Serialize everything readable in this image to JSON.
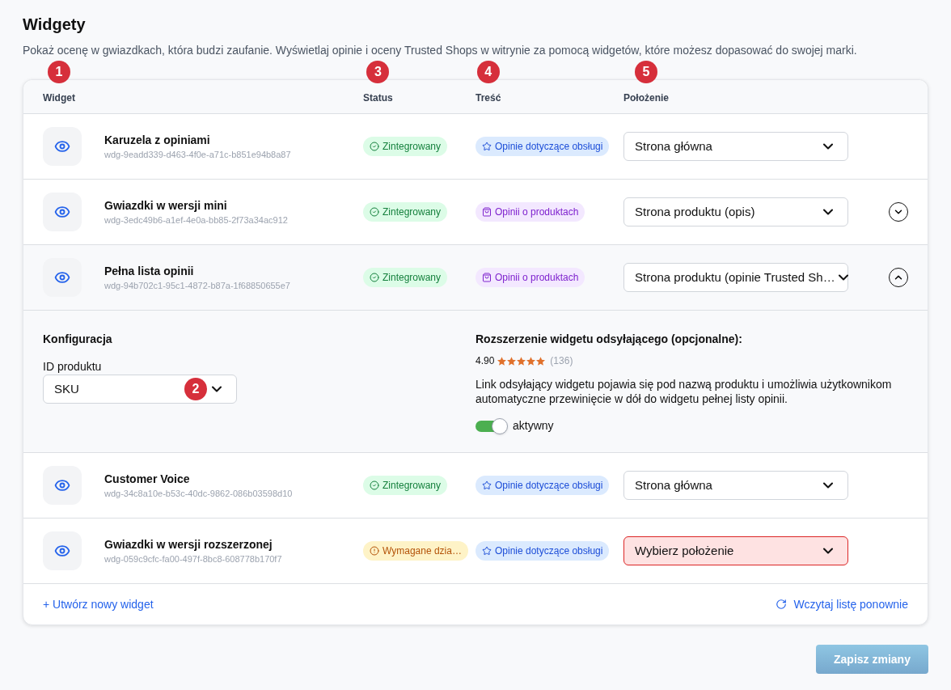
{
  "page": {
    "title": "Widgety",
    "description": "Pokaż ocenę w gwiazdkach, która budzi zaufanie. Wyświetlaj opinie i oceny Trusted Shops w witrynie za pomocą widgetów, które możesz dopasować do swojej marki."
  },
  "table": {
    "columns": [
      {
        "label": "Widget",
        "marker": "1"
      },
      {
        "label": "Status",
        "marker": "3"
      },
      {
        "label": "Treść",
        "marker": "4"
      },
      {
        "label": "Położenie",
        "marker": "5"
      }
    ],
    "rows": [
      {
        "name": "Karuzela z opiniami",
        "id": "wdg-9eadd339-d463-4f0e-a71c-b851e94b8a87",
        "status": {
          "kind": "ok",
          "label": "Zintegrowany"
        },
        "content": {
          "kind": "service",
          "label": "Opinie dotyczące obsługi"
        },
        "placement": {
          "value": "Strona główna",
          "invalid": false
        }
      },
      {
        "name": "Gwiazdki w wersji mini",
        "id": "wdg-3edc49b6-a1ef-4e0a-bb85-2f73a34ac912",
        "status": {
          "kind": "ok",
          "label": "Zintegrowany"
        },
        "content": {
          "kind": "product",
          "label": "Opinii o produktach"
        },
        "placement": {
          "value": "Strona produktu (opis)",
          "invalid": false
        },
        "expanded": false
      },
      {
        "name": "Pełna lista opinii",
        "id": "wdg-94b702c1-95c1-4872-b87a-1f68850655e7",
        "status": {
          "kind": "ok",
          "label": "Zintegrowany"
        },
        "content": {
          "kind": "product",
          "label": "Opinii o produktach"
        },
        "placement": {
          "value": "Strona produktu (opinie Trusted Sh…",
          "invalid": false
        },
        "expanded": true,
        "details": {
          "config": {
            "title": "Konfiguracja",
            "field_label": "ID produktu",
            "value": "SKU",
            "marker": "2"
          },
          "extension": {
            "title": "Rozszerzenie widgetu odsyłającego (opcjonalne):",
            "rating": "4.90",
            "stars": 5,
            "count": "(136)",
            "description": "Link odsyłający widgetu pojawia się pod nazwą produktu i umożliwia użytkownikom automatyczne przewinięcie w dół do widgetu pełnej listy opinii.",
            "toggle": {
              "label": "aktywny",
              "on": true
            }
          }
        }
      },
      {
        "name": "Customer Voice",
        "id": "wdg-34c8a10e-b53c-40dc-9862-086b03598d10",
        "status": {
          "kind": "ok",
          "label": "Zintegrowany"
        },
        "content": {
          "kind": "service",
          "label": "Opinie dotyczące obsługi"
        },
        "placement": {
          "value": "Strona główna",
          "invalid": false
        }
      },
      {
        "name": "Gwiazdki w wersji rozszerzonej",
        "id": "wdg-059c9cfc-fa00-497f-8bc8-608778b170f7",
        "status": {
          "kind": "warning",
          "label": "Wymagane dzia…"
        },
        "content": {
          "kind": "service",
          "label": "Opinie dotyczące obsługi"
        },
        "placement": {
          "placeholder": "Wybierz położenie",
          "invalid": true
        }
      }
    ],
    "footer": {
      "create_link": "+ Utwórz nowy widget",
      "reload_link": "Wczytaj listę ponownie"
    }
  },
  "save_button": {
    "label": "Zapisz zmiany",
    "disabled": true
  }
}
